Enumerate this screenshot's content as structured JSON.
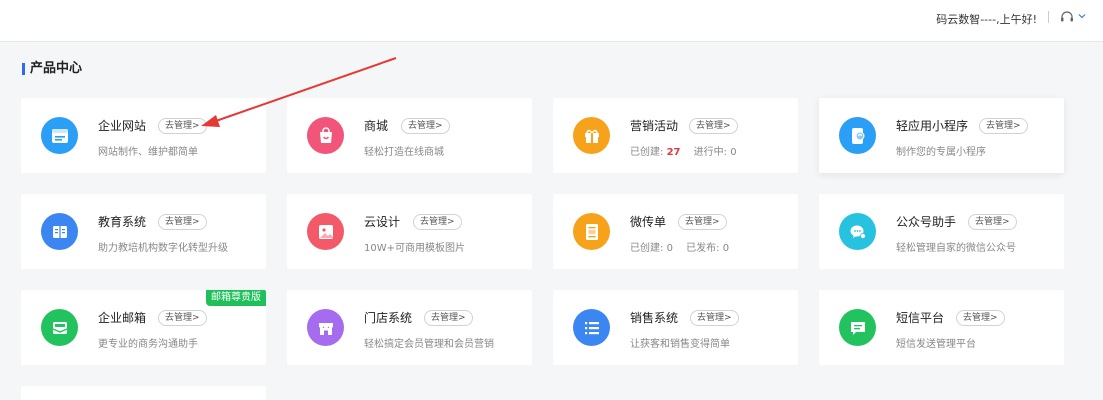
{
  "header": {
    "greeting": "码云数智----,上午好!"
  },
  "section": {
    "title": "产品中心"
  },
  "manage_label": "去管理>",
  "cards": [
    {
      "name": "企业网站",
      "desc": "网站制作、维护都简单",
      "icon": "website-icon",
      "color": "#2b9ef5"
    },
    {
      "name": "商城",
      "desc": "轻松打造在线商城",
      "icon": "shopping-bag-icon",
      "color": "#f2557a"
    },
    {
      "name": "营销活动",
      "desc_parts": {
        "created_label": "已创建:",
        "created": "27",
        "active_label": "进行中:",
        "active": "0"
      },
      "icon": "gift-icon",
      "color": "#f7a21b"
    },
    {
      "name": "轻应用小程序",
      "desc": "制作您的专属小程序",
      "icon": "mini-program-icon",
      "color": "#2b9ef5"
    },
    {
      "name": "教育系统",
      "desc": "助力教培机构数字化转型升级",
      "icon": "book-icon",
      "color": "#3b86f0"
    },
    {
      "name": "云设计",
      "desc": "10W+可商用模板图片",
      "icon": "image-icon",
      "color": "#f25a6a"
    },
    {
      "name": "微传单",
      "desc_parts": {
        "created_label": "已创建:",
        "created": "0",
        "active_label": "已发布:",
        "active": "0"
      },
      "icon": "flyer-icon",
      "color": "#f7a21b"
    },
    {
      "name": "公众号助手",
      "desc": "轻松管理自家的微信公众号",
      "icon": "wechat-icon",
      "color": "#26c2e0"
    },
    {
      "name": "企业邮箱",
      "desc": "更专业的商务沟通助手",
      "badge": "邮箱尊贵版",
      "icon": "mail-icon",
      "color": "#22c35e"
    },
    {
      "name": "门店系统",
      "desc": "轻松搞定会员管理和会员营销",
      "icon": "store-icon",
      "color": "#a66cf0"
    },
    {
      "name": "销售系统",
      "desc": "让获客和销售变得简单",
      "icon": "list-icon",
      "color": "#3b86f0"
    },
    {
      "name": "短信平台",
      "desc": "短信发送管理平台",
      "icon": "sms-icon",
      "color": "#22c35e"
    }
  ]
}
